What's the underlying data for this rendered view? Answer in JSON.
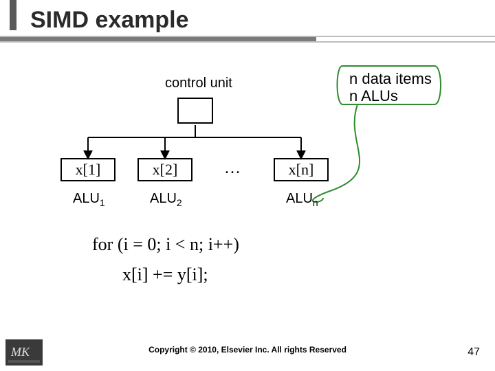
{
  "title": "SIMD example",
  "control_label": "control unit",
  "legend": {
    "line1": "n data items",
    "line2": "n ALUs"
  },
  "x_boxes": {
    "x1": "x[1]",
    "x2": "x[2]",
    "xn": "x[n]"
  },
  "ellipsis": "…",
  "alu_labels": {
    "a1": {
      "text": "ALU",
      "sub": "1"
    },
    "a2": {
      "text": "ALU",
      "sub": "2"
    },
    "an": {
      "text": "ALU",
      "sub": "n"
    }
  },
  "code": {
    "line1": "for (i = 0; i < n; i++)",
    "line2": "x[i] += y[i];"
  },
  "copyright": "Copyright © 2010, Elsevier Inc. All rights Reserved",
  "page_num": "47",
  "logo_text": "MK"
}
